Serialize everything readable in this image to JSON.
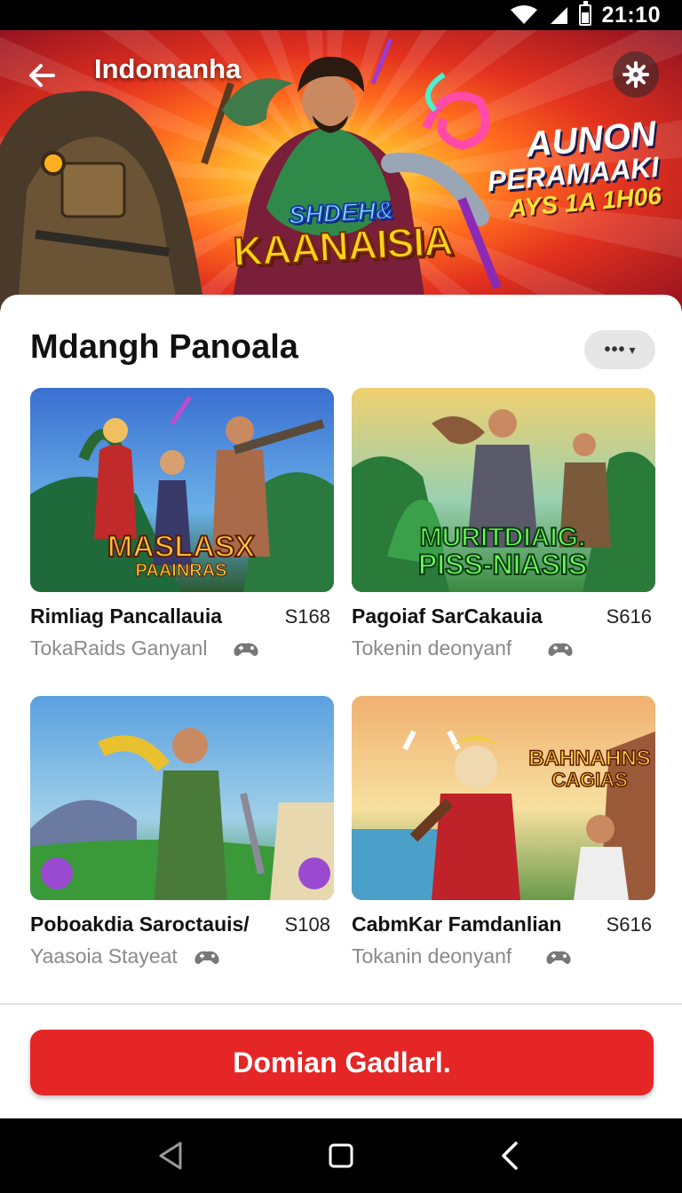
{
  "status_bar": {
    "time": "21:10"
  },
  "header": {
    "title": "Indomanha"
  },
  "banner": {
    "logo_line1": "SHDEH&",
    "logo_line2": "KAANAISIA",
    "promo_line1": "AUNON",
    "promo_line2": "PERAMAAKI",
    "promo_line3": "AYS 1A 1H06"
  },
  "section": {
    "title": "Mdangh Panoala",
    "more_label": "•••"
  },
  "cards": [
    {
      "title": "Rimliag Pancallauia",
      "price": "S168",
      "subtitle": "TokaRaids Ganyanl",
      "art_line1": "MASLASX",
      "art_line2": "PAAINRAS"
    },
    {
      "title": "Pagoiaf SarCakauia",
      "price": "S616",
      "subtitle": "Tokenin deonyanf",
      "art_line1": "MURITDIAIG.",
      "art_line2": "PISS-NIASIS"
    },
    {
      "title": "Poboakdia Saroctauis/",
      "price": "S108",
      "subtitle": "Yaasoia Stayeat",
      "art_line1": "",
      "art_line2": ""
    },
    {
      "title": "CabmKar Famdanlian",
      "price": "S616",
      "subtitle": "Tokanin deonyanf",
      "art_line1": "BAHNAHNS",
      "art_line2": "CAGIAS"
    }
  ],
  "cta": {
    "label": "Domian Gadlarl."
  },
  "colors": {
    "accent": "#e52627",
    "sheet": "#ffffff",
    "text": "#111111",
    "muted": "#8a8a8a"
  },
  "icons": [
    "back-arrow-icon",
    "gear-icon",
    "wifi-icon",
    "signal-icon",
    "battery-icon",
    "controller-icon",
    "nav-back-icon",
    "nav-home-icon",
    "nav-recents-icon"
  ]
}
